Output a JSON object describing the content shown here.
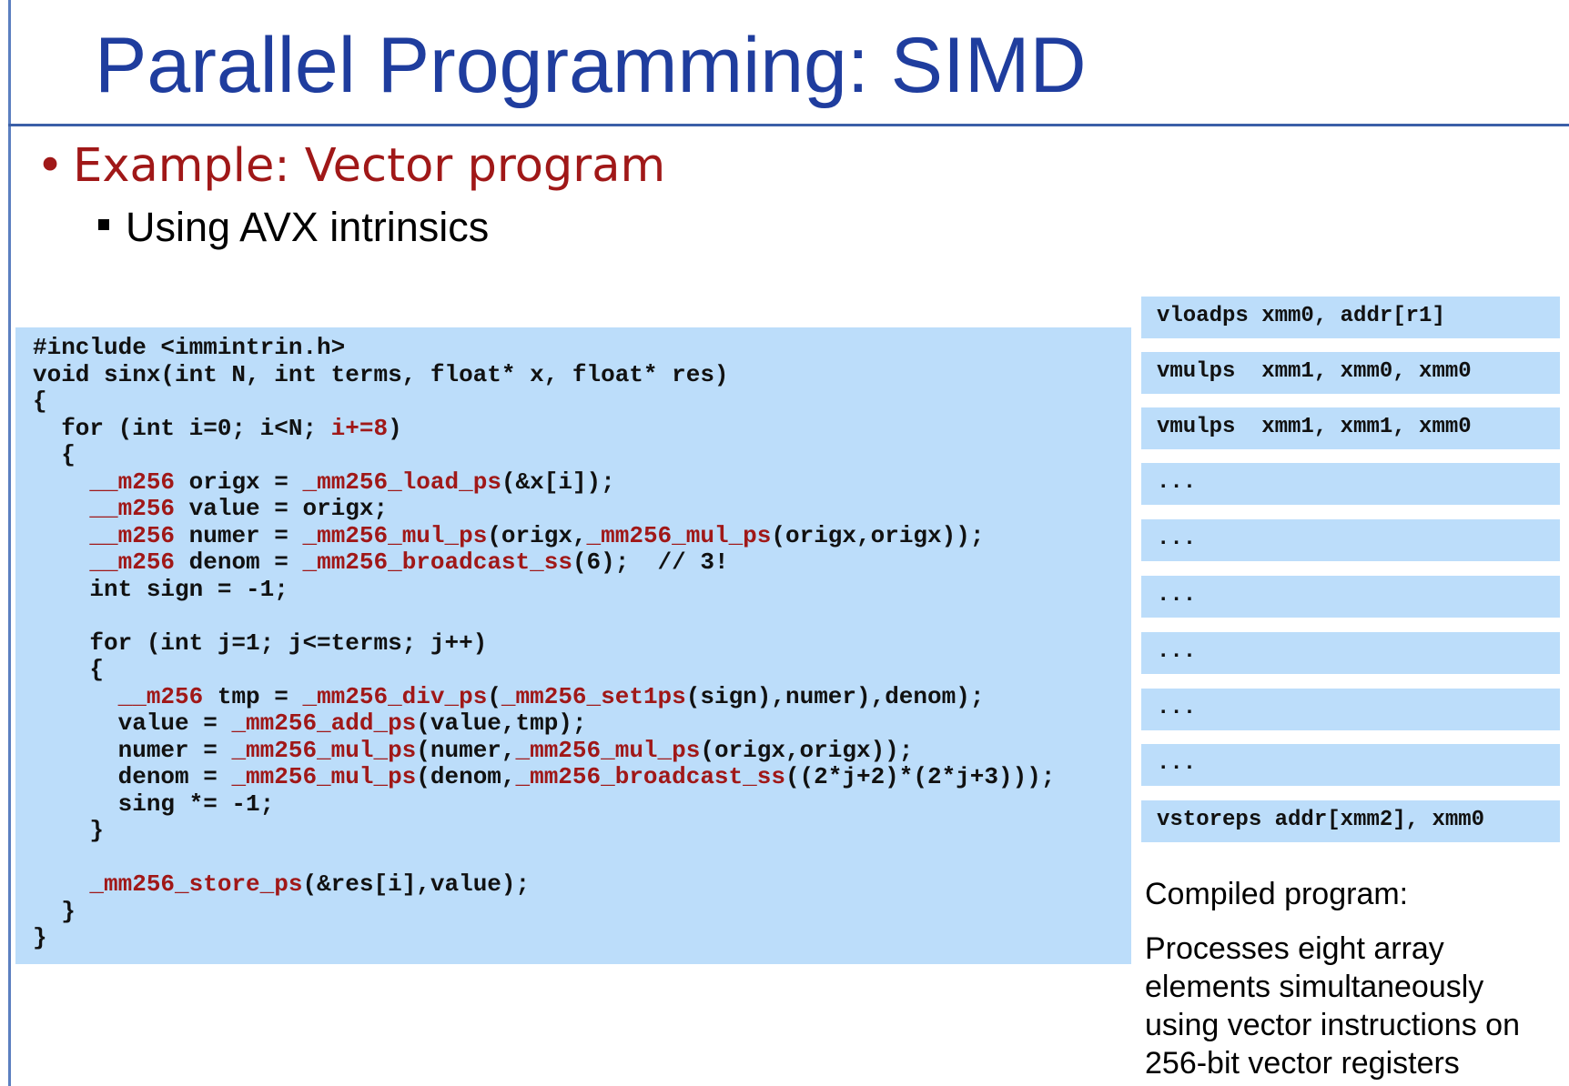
{
  "slide": {
    "title": "Parallel Programming: SIMD",
    "bullet_level1": "Example: Vector program",
    "bullet_level2": "Using AVX intrinsics"
  },
  "code": {
    "lines": [
      [
        {
          "t": "#include <immintrin.h>"
        }
      ],
      [
        {
          "t": "void sinx(int N, int terms, float* x, float* res)"
        }
      ],
      [
        {
          "t": "{"
        }
      ],
      [
        {
          "t": "  for (int i=0; i<N; "
        },
        {
          "t": "i+=8",
          "hl": true
        },
        {
          "t": ")"
        }
      ],
      [
        {
          "t": "  {"
        }
      ],
      [
        {
          "t": "    "
        },
        {
          "t": "__m256",
          "hl": true
        },
        {
          "t": " origx = "
        },
        {
          "t": "_mm256_load_ps",
          "hl": true
        },
        {
          "t": "(&x[i]);"
        }
      ],
      [
        {
          "t": "    "
        },
        {
          "t": "__m256",
          "hl": true
        },
        {
          "t": " value = origx;"
        }
      ],
      [
        {
          "t": "    "
        },
        {
          "t": "__m256",
          "hl": true
        },
        {
          "t": " numer = "
        },
        {
          "t": "_mm256_mul_ps",
          "hl": true
        },
        {
          "t": "(origx,"
        },
        {
          "t": "_mm256_mul_ps",
          "hl": true
        },
        {
          "t": "(origx,origx));"
        }
      ],
      [
        {
          "t": "    "
        },
        {
          "t": "__m256",
          "hl": true
        },
        {
          "t": " denom = "
        },
        {
          "t": "_mm256_broadcast_ss",
          "hl": true
        },
        {
          "t": "(6);  // 3!"
        }
      ],
      [
        {
          "t": "    int sign = -1;"
        }
      ],
      [
        {
          "t": ""
        }
      ],
      [
        {
          "t": "    for (int j=1; j<=terms; j++)"
        }
      ],
      [
        {
          "t": "    {"
        }
      ],
      [
        {
          "t": "      "
        },
        {
          "t": "__m256",
          "hl": true
        },
        {
          "t": " tmp = "
        },
        {
          "t": "_mm256_div_ps",
          "hl": true
        },
        {
          "t": "("
        },
        {
          "t": "_mm256_set1ps",
          "hl": true
        },
        {
          "t": "(sign),numer),denom);"
        }
      ],
      [
        {
          "t": "      value = "
        },
        {
          "t": "_mm256_add_ps",
          "hl": true
        },
        {
          "t": "(value,tmp);"
        }
      ],
      [
        {
          "t": "      numer = "
        },
        {
          "t": "_mm256_mul_ps",
          "hl": true
        },
        {
          "t": "(numer,"
        },
        {
          "t": "_mm256_mul_ps",
          "hl": true
        },
        {
          "t": "(origx,origx));"
        }
      ],
      [
        {
          "t": "      denom = "
        },
        {
          "t": "_mm256_mul_ps",
          "hl": true
        },
        {
          "t": "(denom,"
        },
        {
          "t": "_mm256_broadcast_ss",
          "hl": true
        },
        {
          "t": "((2*j+2)*(2*j+3)));"
        }
      ],
      [
        {
          "t": "      sing *= -1;"
        }
      ],
      [
        {
          "t": "    }"
        }
      ],
      [
        {
          "t": ""
        }
      ],
      [
        {
          "t": "    "
        },
        {
          "t": "_mm256_store_ps",
          "hl": true
        },
        {
          "t": "(&res[i],value);"
        }
      ],
      [
        {
          "t": "  }"
        }
      ],
      [
        {
          "t": "}"
        }
      ]
    ]
  },
  "asm": [
    "vloadps xmm0, addr[r1]",
    "vmulps  xmm1, xmm0, xmm0",
    "vmulps  xmm1, xmm1, xmm0",
    "...",
    "...",
    "...",
    "...",
    "...",
    "...",
    "vstoreps addr[xmm2], xmm0"
  ],
  "compiled": {
    "title": "Compiled program:",
    "description": "Processes eight array elements simultaneously using vector instructions on 256-bit vector registers"
  }
}
